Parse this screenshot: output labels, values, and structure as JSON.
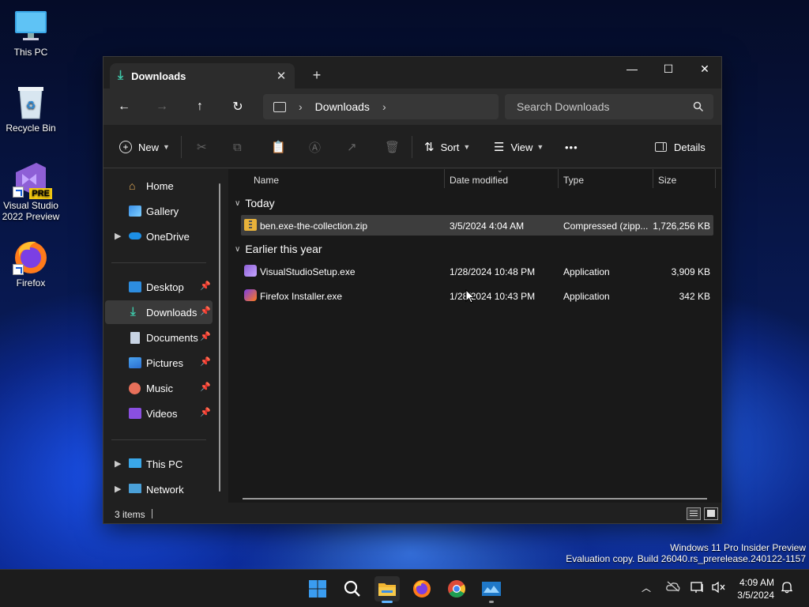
{
  "desktop": {
    "icons": [
      {
        "label": "This PC"
      },
      {
        "label": "Recycle Bin"
      },
      {
        "label": "Visual Studio 2022 Preview",
        "badge": "PRE"
      },
      {
        "label": "Firefox"
      }
    ]
  },
  "window": {
    "tab_title": "Downloads",
    "tab_close": "✕",
    "new_tab": "+",
    "controls": {
      "minimize": "—",
      "maximize": "☐",
      "close": "✕"
    },
    "nav": {
      "back": "←",
      "forward": "→",
      "up": "↑",
      "refresh": "↻"
    },
    "address": {
      "segments": [
        "Downloads"
      ],
      "sep": "›"
    },
    "search": {
      "placeholder": "Search Downloads"
    },
    "toolbar": {
      "new_label": "New",
      "sort_label": "Sort",
      "view_label": "View",
      "more_label": "•••",
      "details_label": "Details"
    },
    "sidebar": {
      "items": [
        {
          "label": "Home"
        },
        {
          "label": "Gallery"
        },
        {
          "label": "OneDrive"
        },
        {
          "label": "Desktop"
        },
        {
          "label": "Downloads"
        },
        {
          "label": "Documents"
        },
        {
          "label": "Pictures"
        },
        {
          "label": "Music"
        },
        {
          "label": "Videos"
        },
        {
          "label": "This PC"
        },
        {
          "label": "Network"
        }
      ]
    },
    "columns": {
      "name": "Name",
      "date": "Date modified",
      "type": "Type",
      "size": "Size"
    },
    "groups": [
      {
        "label": "Today"
      },
      {
        "label": "Earlier this year"
      }
    ],
    "files": [
      {
        "name": "ben.exe-the-collection.zip",
        "date": "3/5/2024 4:04 AM",
        "type": "Compressed (zipp...",
        "size": "1,726,256 KB"
      },
      {
        "name": "VisualStudioSetup.exe",
        "date": "1/28/2024 10:48 PM",
        "type": "Application",
        "size": "3,909 KB"
      },
      {
        "name": "Firefox Installer.exe",
        "date": "1/28/2024 10:43 PM",
        "type": "Application",
        "size": "342 KB"
      }
    ],
    "status": {
      "items_count": "3 items"
    }
  },
  "watermark": {
    "line1": "Windows 11 Pro Insider Preview",
    "line2": "Evaluation copy. Build 26040.rs_prerelease.240122-1157"
  },
  "taskbar": {
    "time": "4:09 AM",
    "date": "3/5/2024"
  },
  "colors": {
    "accent": "#60b5ff",
    "selection": "#3d3d3d",
    "window_bg": "#202020"
  }
}
